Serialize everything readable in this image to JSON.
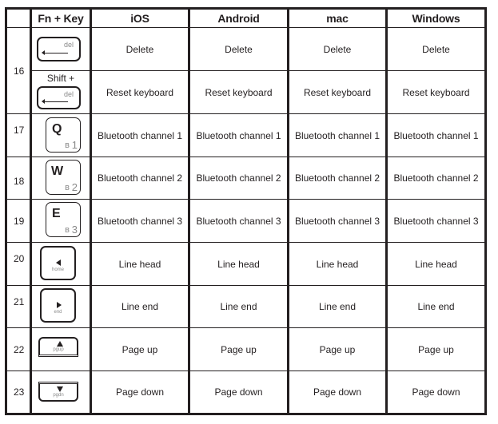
{
  "header": {
    "number_col": "",
    "fnkey": "Fn + Key",
    "ios": "iOS",
    "android": "Android",
    "mac": "mac",
    "windows": "Windows"
  },
  "rows": [
    {
      "num": "16",
      "key_label": "del",
      "key_prefix": "",
      "icon": "delete-key-icon",
      "ios": "Delete",
      "android": "Delete",
      "mac": "Delete",
      "windows": "Delete"
    },
    {
      "num": "",
      "key_label": "del",
      "key_prefix": "Shift +",
      "icon": "shift-delete-key-icon",
      "ios": "Reset keyboard",
      "android": "Reset keyboard",
      "mac": "Reset keyboard",
      "windows": "Reset keyboard"
    },
    {
      "num": "17",
      "key_label": "Q",
      "key_sub": "1",
      "icon": "q-bluetooth-1-key-icon",
      "ios": "Bluetooth channel 1",
      "android": "Bluetooth channel 1",
      "mac": "Bluetooth channel 1",
      "windows": "Bluetooth channel 1"
    },
    {
      "num": "18",
      "key_label": "W",
      "key_sub": "2",
      "icon": "w-bluetooth-2-key-icon",
      "ios": "Bluetooth channel 2",
      "android": "Bluetooth channel 2",
      "mac": "Bluetooth channel 2",
      "windows": "Bluetooth channel 2"
    },
    {
      "num": "19",
      "key_label": "E",
      "key_sub": "3",
      "icon": "e-bluetooth-3-key-icon",
      "ios": "Bluetooth channel 3",
      "android": "Bluetooth channel 3",
      "mac": "Bluetooth channel 3",
      "windows": "Bluetooth channel 3"
    },
    {
      "num": "20",
      "key_label": "home",
      "icon": "home-key-icon",
      "ios": "Line head",
      "android": "Line head",
      "mac": "Line head",
      "windows": "Line head"
    },
    {
      "num": "21",
      "key_label": "end",
      "icon": "end-key-icon",
      "ios": "Line end",
      "android": "Line end",
      "mac": "Line end",
      "windows": "Line end"
    },
    {
      "num": "22",
      "key_label": "pgup",
      "icon": "page-up-key-icon",
      "ios": "Page up",
      "android": "Page up",
      "mac": "Page up",
      "windows": "Page up"
    },
    {
      "num": "23",
      "key_label": "pgdn",
      "icon": "page-down-key-icon",
      "ios": "Page down",
      "android": "Page down",
      "mac": "Page down",
      "windows": "Page down"
    }
  ]
}
